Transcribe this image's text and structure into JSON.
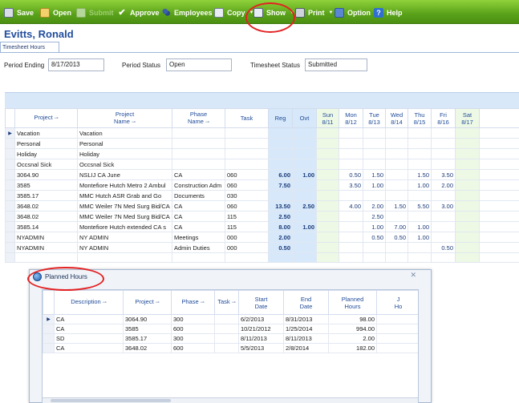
{
  "toolbar": {
    "save": "Save",
    "open": "Open",
    "submit": "Submit",
    "approve": "Approve",
    "employees": "Employees",
    "copy": "Copy",
    "show": "Show",
    "print": "Print",
    "option": "Option",
    "help": "Help"
  },
  "employee": {
    "name": "Evitts, Ronald"
  },
  "tab": {
    "label": "Timesheet Hours"
  },
  "fields": {
    "period_ending_label": "Period Ending",
    "period_ending_value": "8/17/2013",
    "period_status_label": "Period Status",
    "period_status_value": "Open",
    "timesheet_status_label": "Timesheet Status",
    "timesheet_status_value": "Submitted"
  },
  "grid": {
    "headers": {
      "project": "Project",
      "project_name_1": "Project",
      "project_name_2": "Name",
      "phase_1": "Phase",
      "phase_2": "Name",
      "task": "Task",
      "reg": "Reg",
      "ovt": "Ovt",
      "sun_1": "Sun",
      "sun_2": "8/11",
      "mon_1": "Mon",
      "mon_2": "8/12",
      "tue_1": "Tue",
      "tue_2": "8/13",
      "wed_1": "Wed",
      "wed_2": "8/14",
      "thu_1": "Thu",
      "thu_2": "8/15",
      "fri_1": "Fri",
      "fri_2": "8/16",
      "sat_1": "Sat",
      "sat_2": "8/17"
    },
    "rows": [
      {
        "sel": "▶",
        "project": "Vacation",
        "name": "Vacation",
        "phase": "",
        "task": "",
        "reg": "",
        "ovt": "",
        "sun": "",
        "mon": "",
        "tue": "",
        "wed": "",
        "thu": "",
        "fri": "",
        "sat": ""
      },
      {
        "sel": "",
        "project": "Personal",
        "name": "Personal",
        "phase": "",
        "task": "",
        "reg": "",
        "ovt": "",
        "sun": "",
        "mon": "",
        "tue": "",
        "wed": "",
        "thu": "",
        "fri": "",
        "sat": ""
      },
      {
        "sel": "",
        "project": "Holiday",
        "name": "Holiday",
        "phase": "",
        "task": "",
        "reg": "",
        "ovt": "",
        "sun": "",
        "mon": "",
        "tue": "",
        "wed": "",
        "thu": "",
        "fri": "",
        "sat": ""
      },
      {
        "sel": "",
        "project": "Occsnal Sick",
        "name": "Occsnal Sick",
        "phase": "",
        "task": "",
        "reg": "",
        "ovt": "",
        "sun": "",
        "mon": "",
        "tue": "",
        "wed": "",
        "thu": "",
        "fri": "",
        "sat": ""
      },
      {
        "sel": "",
        "project": "3064.90",
        "name": "NSLIJ CA June",
        "phase": "CA",
        "task": "060",
        "reg": "6.00",
        "ovt": "1.00",
        "sun": "",
        "mon": "0.50",
        "tue": "1.50",
        "wed": "",
        "thu": "1.50",
        "fri": "3.50",
        "sat": ""
      },
      {
        "sel": "",
        "project": "3585",
        "name": "Montefiore Hutch Metro 2 Ambul",
        "phase": "Construction Adm",
        "task": "060",
        "reg": "7.50",
        "ovt": "",
        "sun": "",
        "mon": "3.50",
        "tue": "1.00",
        "wed": "",
        "thu": "1.00",
        "fri": "2.00",
        "sat": ""
      },
      {
        "sel": "",
        "project": "3585.17",
        "name": "MMC Hutch ASR Grab and Go",
        "phase": "Documents",
        "task": "030",
        "reg": "",
        "ovt": "",
        "sun": "",
        "mon": "",
        "tue": "",
        "wed": "",
        "thu": "",
        "fri": "",
        "sat": ""
      },
      {
        "sel": "",
        "project": "3648.02",
        "name": "MMC Weiler 7N Med Surg Bid/CA",
        "phase": "CA",
        "task": "060",
        "reg": "13.50",
        "ovt": "2.50",
        "sun": "",
        "mon": "4.00",
        "tue": "2.00",
        "wed": "1.50",
        "thu": "5.50",
        "fri": "3.00",
        "sat": ""
      },
      {
        "sel": "",
        "project": "3648.02",
        "name": "MMC Weiler 7N Med Surg Bid/CA",
        "phase": "CA",
        "task": "115",
        "reg": "2.50",
        "ovt": "",
        "sun": "",
        "mon": "",
        "tue": "2.50",
        "wed": "",
        "thu": "",
        "fri": "",
        "sat": ""
      },
      {
        "sel": "",
        "project": "3585.14",
        "name": "Montefiore Hutch extended CA s",
        "phase": "CA",
        "task": "115",
        "reg": "8.00",
        "ovt": "1.00",
        "sun": "",
        "mon": "",
        "tue": "1.00",
        "wed": "7.00",
        "thu": "1.00",
        "fri": "",
        "sat": ""
      },
      {
        "sel": "",
        "project": "NYADMIN",
        "name": "NY ADMIN",
        "phase": "Meetings",
        "task": "000",
        "reg": "2.00",
        "ovt": "",
        "sun": "",
        "mon": "",
        "tue": "0.50",
        "wed": "0.50",
        "thu": "1.00",
        "fri": "",
        "sat": ""
      },
      {
        "sel": "",
        "project": "NYADMIN",
        "name": "NY ADMIN",
        "phase": "Admin Duties",
        "task": "000",
        "reg": "0.50",
        "ovt": "",
        "sun": "",
        "mon": "",
        "tue": "",
        "wed": "",
        "thu": "",
        "fri": "0.50",
        "sat": ""
      }
    ]
  },
  "popup": {
    "title": "Planned Hours",
    "close": "✕",
    "headers": {
      "description": "Description",
      "project": "Project",
      "phase": "Phase",
      "task": "Task",
      "start_1": "Start",
      "start_2": "Date",
      "end_1": "End",
      "end_2": "Date",
      "planned_1": "Planned",
      "planned_2": "Hours",
      "extra_1": "J",
      "extra_2": "Ho"
    },
    "rows": [
      {
        "sel": "▶",
        "description": "CA",
        "project": "3064.90",
        "phase": "300",
        "task": "",
        "start": "6/2/2013",
        "end": "8/31/2013",
        "planned": "98.00"
      },
      {
        "sel": "",
        "description": "CA",
        "project": "3585",
        "phase": "600",
        "task": "",
        "start": "10/21/2012",
        "end": "1/25/2014",
        "planned": "994.00"
      },
      {
        "sel": "",
        "description": "SD",
        "project": "3585.17",
        "phase": "300",
        "task": "",
        "start": "8/11/2013",
        "end": "8/11/2013",
        "planned": "2.00"
      },
      {
        "sel": "",
        "description": "CA",
        "project": "3648.02",
        "phase": "600",
        "task": "",
        "start": "5/5/2013",
        "end": "2/8/2014",
        "planned": "182.00"
      }
    ]
  },
  "icons": {
    "save": "save-icon",
    "open": "folder-icon",
    "submit": "submit-icon",
    "approve": "check-icon",
    "employees": "people-icon",
    "copy": "copy-icon",
    "show": "document-icon",
    "print": "printer-icon",
    "option": "option-icon",
    "help": "help-icon",
    "pin": "pin-icon",
    "globe": "globe-icon"
  },
  "colors": {
    "toolbar": "#5aa21a",
    "header_text": "#1f4b99",
    "reg_ovt_column": "#d6e8fa",
    "weekend_column": "#eef9e5",
    "annotation": "#e32222"
  }
}
